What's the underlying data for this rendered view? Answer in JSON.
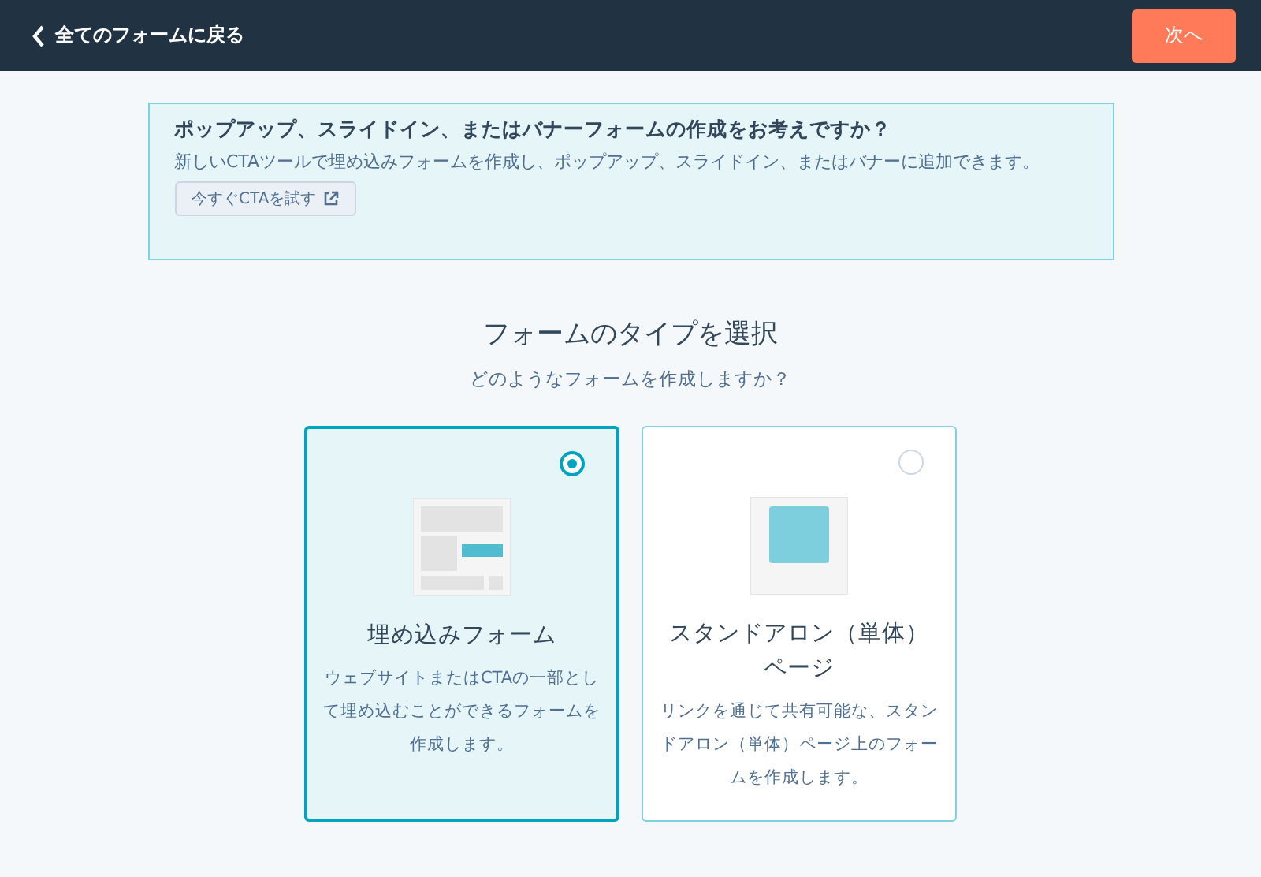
{
  "header": {
    "back_link": "全てのフォームに戻る",
    "next_button": "次へ"
  },
  "banner": {
    "title": "ポップアップ、スライドイン、またはバナーフォームの作成をお考えですか？",
    "text": "新しいCTAツールで埋め込みフォームを作成し、ポップアップ、スライドイン、またはバナーに追加できます。",
    "button": "今すぐCTAを試す"
  },
  "heading": "フォームのタイプを選択",
  "subheading": "どのようなフォームを作成しますか？",
  "options": [
    {
      "kind": "embedded",
      "title": "埋め込みフォーム",
      "description": "ウェブサイトまたはCTAの一部として埋め込むことができるフォームを作成します。",
      "selected": true
    },
    {
      "kind": "standalone",
      "title": "スタンドアロン（単体）ページ",
      "description": "リンクを通じて共有可能な、スタンドアロン（単体）ページ上のフォームを作成します。",
      "selected": false
    }
  ]
}
